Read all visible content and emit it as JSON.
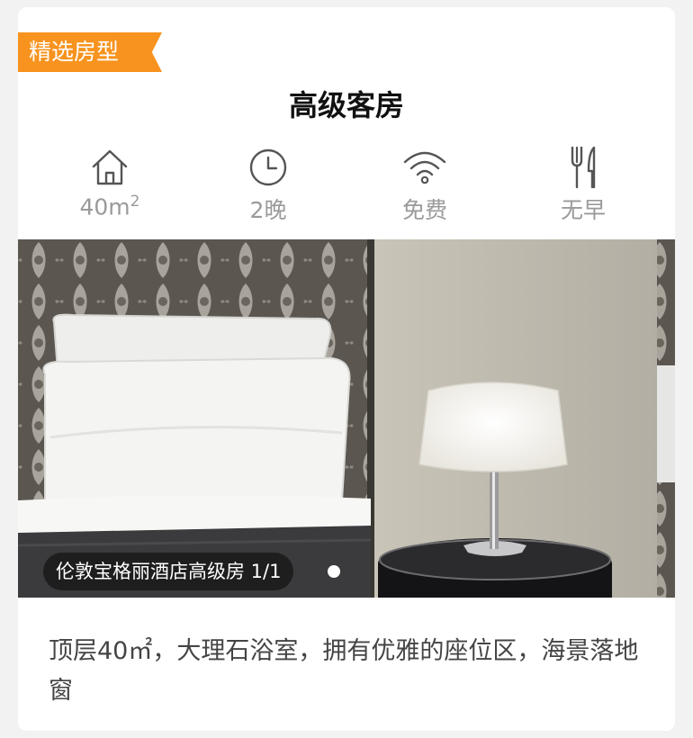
{
  "card": {
    "badge": "精选房型",
    "title": "高级客房",
    "amenities": [
      {
        "icon": "house-icon",
        "value": "40m",
        "sup": "2"
      },
      {
        "icon": "clock-icon",
        "value": "2晚"
      },
      {
        "icon": "wifi-icon",
        "value": "免费"
      },
      {
        "icon": "fork-knife-icon",
        "value": "无早"
      }
    ],
    "photo": {
      "caption": "伦敦宝格丽酒店高级房 1/1"
    },
    "description": "顶层40㎡，大理石浴室，拥有优雅的座位区，海景落地窗"
  },
  "colors": {
    "badge": "#f7931e",
    "icon": "#555555",
    "label": "#9a9a9a",
    "description": "#444444"
  }
}
